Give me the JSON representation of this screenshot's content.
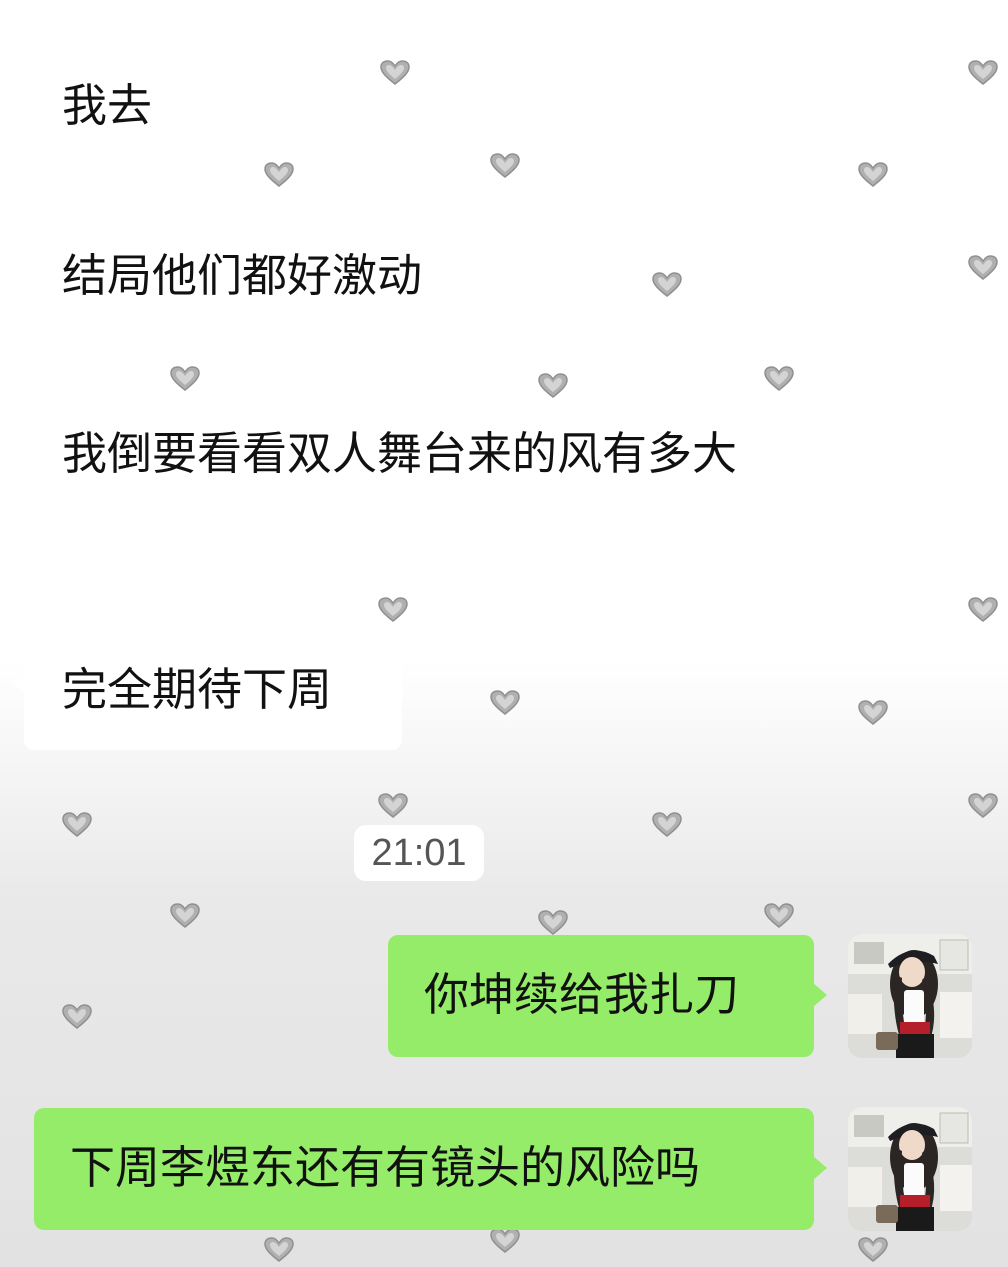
{
  "messages": {
    "m1": "我去",
    "m2": "结局他们都好激动",
    "m3": "我倒要看看双人舞台来的风有多大",
    "m4": "完全期待下周",
    "timestamp": "21:01",
    "m5": "你坤续给我扎刀",
    "m6": "下周李煜东还有有镜头的风险吗"
  },
  "colors": {
    "incoming_bubble": "#ffffff",
    "outgoing_bubble": "#95ec69",
    "heart": "#b0b0b0"
  },
  "icons": {
    "background_pattern": "heart-icon",
    "avatar": "avatar"
  }
}
